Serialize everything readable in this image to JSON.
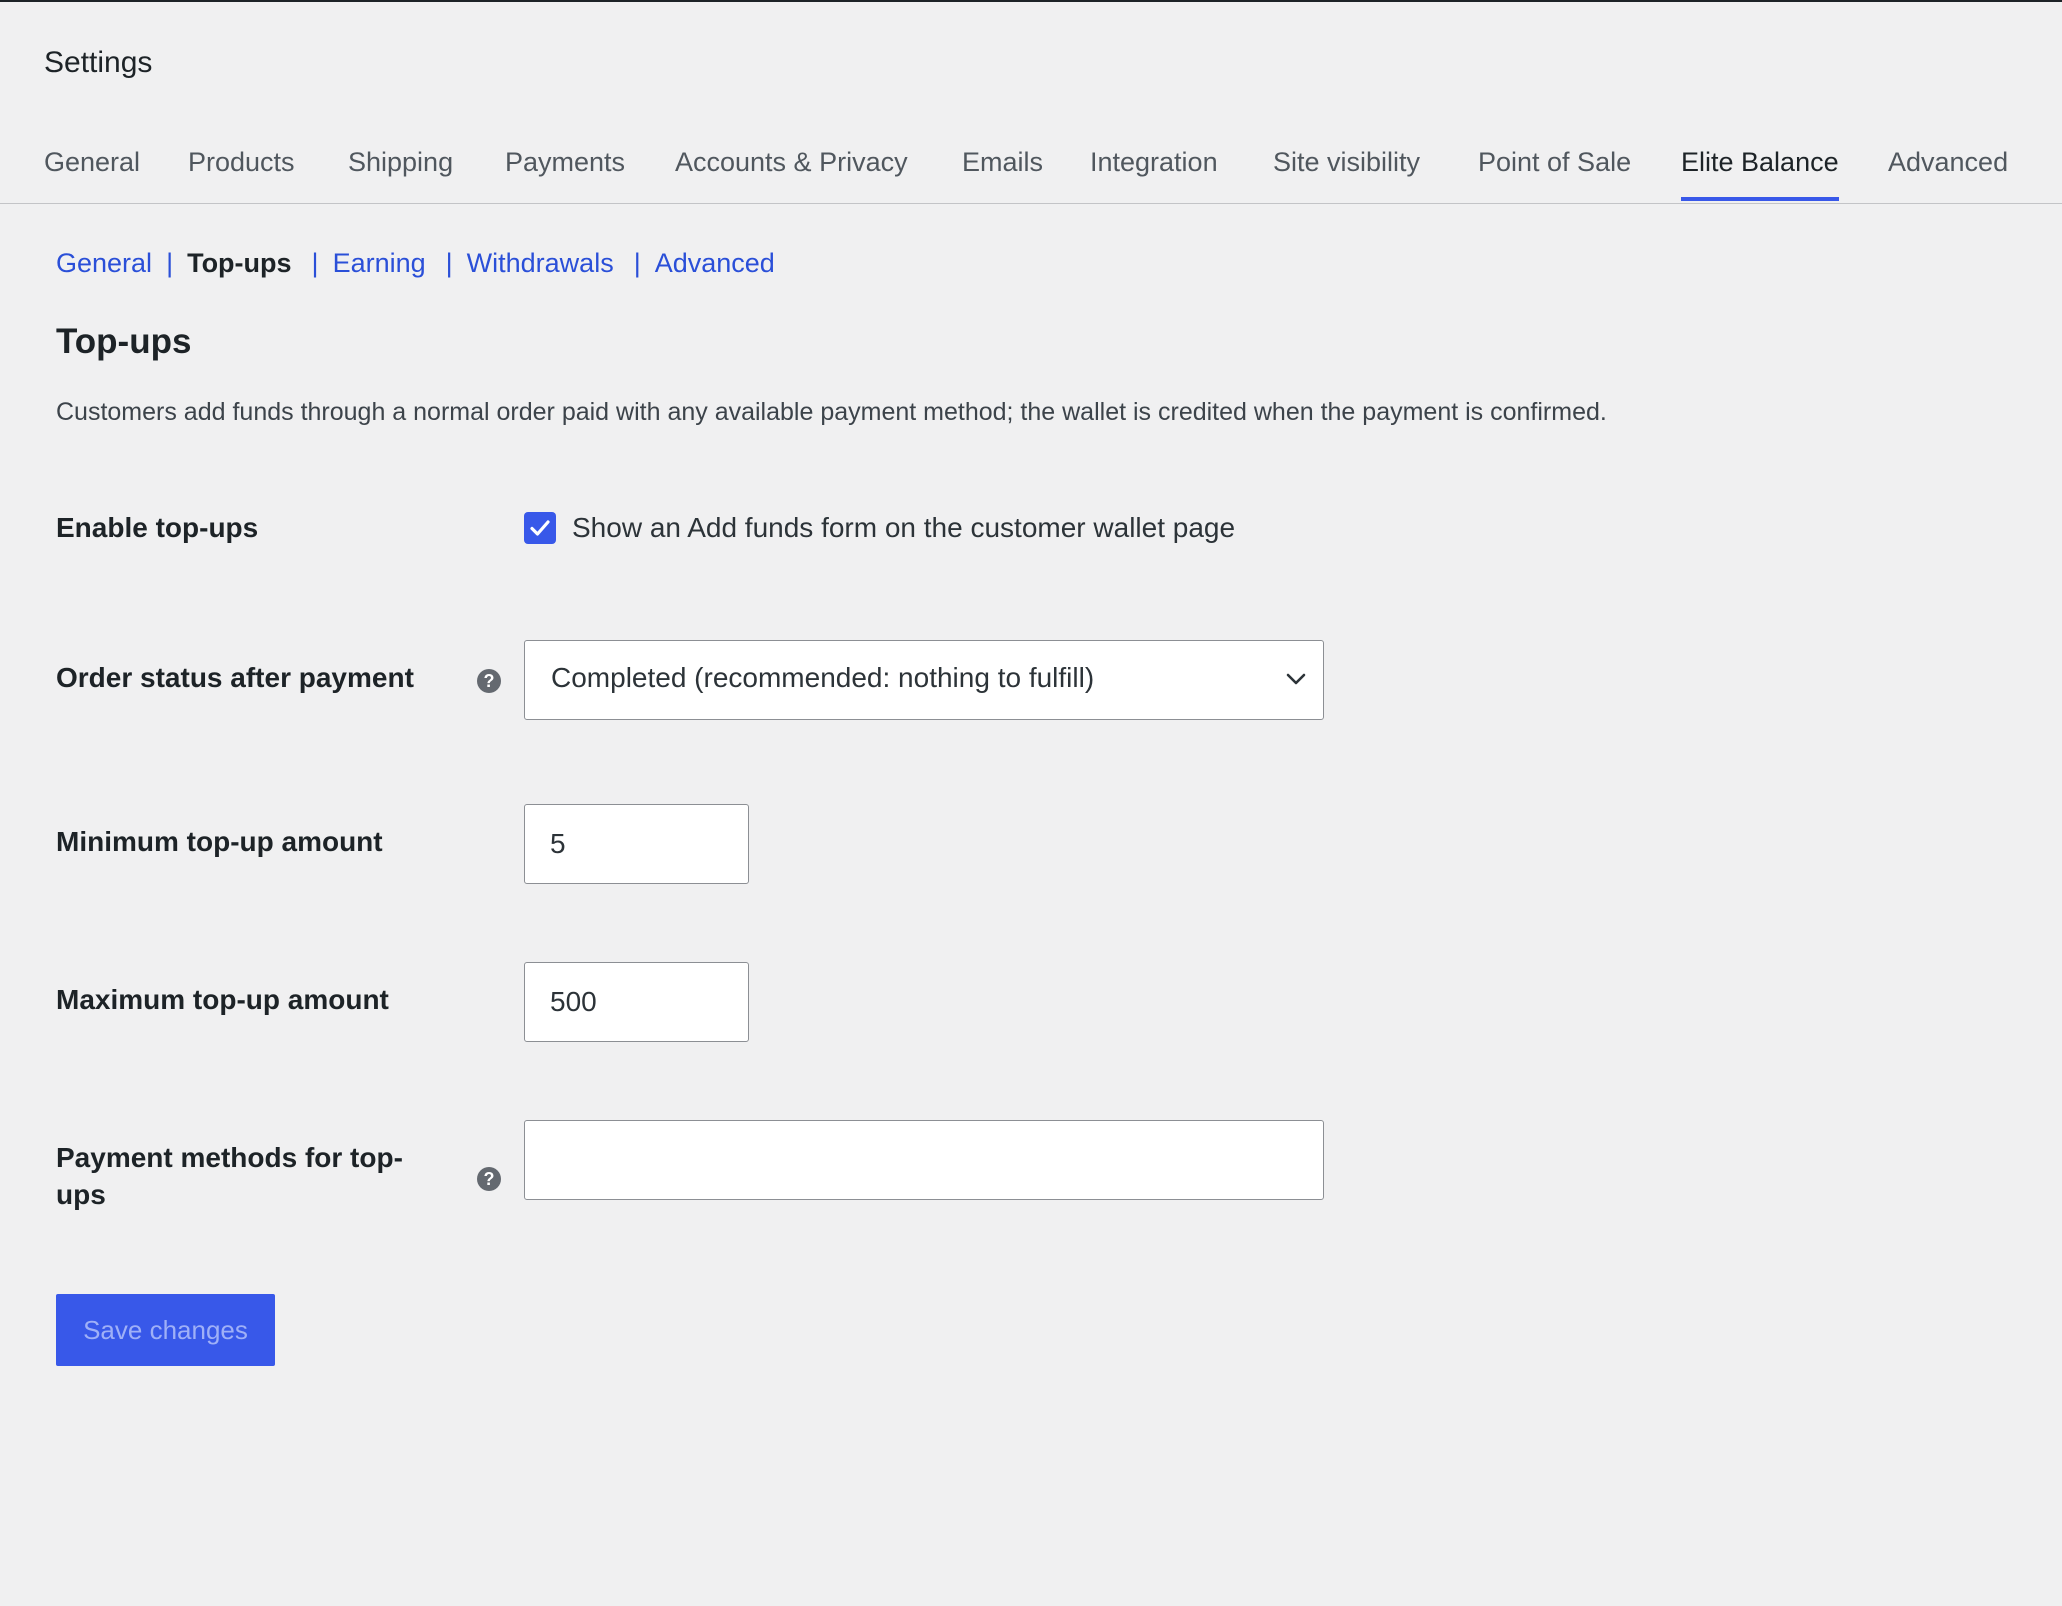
{
  "header": {
    "title": "Settings"
  },
  "tabs": [
    {
      "label": "General",
      "active": false
    },
    {
      "label": "Products",
      "active": false
    },
    {
      "label": "Shipping",
      "active": false
    },
    {
      "label": "Payments",
      "active": false
    },
    {
      "label": "Accounts & Privacy",
      "active": false
    },
    {
      "label": "Emails",
      "active": false
    },
    {
      "label": "Integration",
      "active": false
    },
    {
      "label": "Site visibility",
      "active": false
    },
    {
      "label": "Point of Sale",
      "active": false
    },
    {
      "label": "Elite Balance",
      "active": true
    },
    {
      "label": "Advanced",
      "active": false
    }
  ],
  "subnav": {
    "separator": "|",
    "items": [
      {
        "label": "General",
        "current": false
      },
      {
        "label": "Top-ups",
        "current": true
      },
      {
        "label": "Earning",
        "current": false
      },
      {
        "label": "Withdrawals",
        "current": false
      },
      {
        "label": "Advanced",
        "current": false
      }
    ]
  },
  "section": {
    "title": "Top-ups",
    "description": "Customers add funds through a normal order paid with any available payment method; the wallet is credited when the payment is confirmed."
  },
  "fields": {
    "enable_topups": {
      "label": "Enable top-ups",
      "checkbox_label": "Show an Add funds form on the customer wallet page",
      "checked": true
    },
    "order_status": {
      "label": "Order status after payment",
      "selected": "Completed (recommended: nothing to fulfill)",
      "help_icon": "question-circle-icon"
    },
    "min_amount": {
      "label": "Minimum top-up amount",
      "value": "5"
    },
    "max_amount": {
      "label": "Maximum top-up amount",
      "value": "500"
    },
    "payment_methods": {
      "label_line1": "Payment methods for top-",
      "label_line2": "ups",
      "value": "",
      "help_icon": "question-circle-icon"
    }
  },
  "actions": {
    "save_label": "Save changes"
  },
  "colors": {
    "accent": "#3858e9",
    "link": "#2a4fd8",
    "background": "#f0f0f1",
    "text": "#1d2327"
  }
}
